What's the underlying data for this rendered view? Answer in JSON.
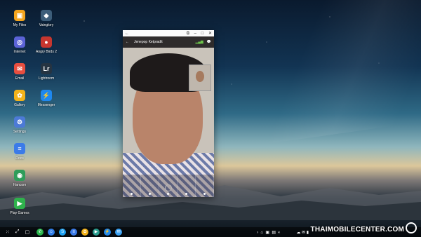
{
  "desktop": {
    "icons": [
      {
        "label": "My Files",
        "icon": "folder-icon",
        "color": "#f4a51e",
        "glyph": "▣"
      },
      {
        "label": "Vainglory",
        "icon": "vainglory-icon",
        "color": "#3d5e7a",
        "glyph": "◆"
      },
      {
        "label": "Internet",
        "icon": "globe-icon",
        "color": "#5b63d6",
        "glyph": "◎"
      },
      {
        "label": "Angry Birds 2",
        "icon": "bird-icon",
        "color": "#c6362f",
        "glyph": "●"
      },
      {
        "label": "Email",
        "icon": "mail-icon",
        "color": "#e84e3f",
        "glyph": "✉"
      },
      {
        "label": "Lightroom",
        "icon": "lightroom-icon",
        "color": "#263442",
        "glyph": "Lr"
      },
      {
        "label": "Gallery",
        "icon": "flower-icon",
        "color": "#f3b31a",
        "glyph": "✿"
      },
      {
        "label": "Messenger",
        "icon": "messenger-icon",
        "color": "#1e88f0",
        "glyph": "⚡"
      },
      {
        "label": "Settings",
        "icon": "gear-icon",
        "color": "#4c7ad6",
        "glyph": "⚙"
      },
      {
        "label": "Docs",
        "icon": "docs-icon",
        "color": "#3b7be8",
        "glyph": "≡"
      },
      {
        "label": "Hancom",
        "icon": "hancom-icon",
        "color": "#2f9d5a",
        "glyph": "◉"
      },
      {
        "label": "Play Games",
        "icon": "play-games-icon",
        "color": "#2fb24c",
        "glyph": "▶"
      }
    ]
  },
  "window": {
    "contact_name": "Jenepop Ketpradit"
  },
  "taskbar": {
    "apps": [
      {
        "icon": "phone-icon",
        "color": "#27b34a",
        "glyph": "✆"
      },
      {
        "icon": "contacts-icon",
        "color": "#2f7de8",
        "glyph": "☺"
      },
      {
        "icon": "skype-icon",
        "color": "#1da1f2",
        "glyph": "S"
      },
      {
        "icon": "docs-icon",
        "color": "#3b7be8",
        "glyph": "≡"
      },
      {
        "icon": "gallery-icon",
        "color": "#f3b31a",
        "glyph": "✿"
      },
      {
        "icon": "play-store-icon",
        "color": "#2a9d8f",
        "glyph": "▶"
      },
      {
        "icon": "messenger-icon",
        "color": "#1e88f0",
        "glyph": "⚡"
      },
      {
        "icon": "messages-icon",
        "color": "#3aa0f0",
        "glyph": "✉"
      }
    ]
  },
  "watermark": {
    "text": "THAIMOBILECENTER.COM"
  }
}
